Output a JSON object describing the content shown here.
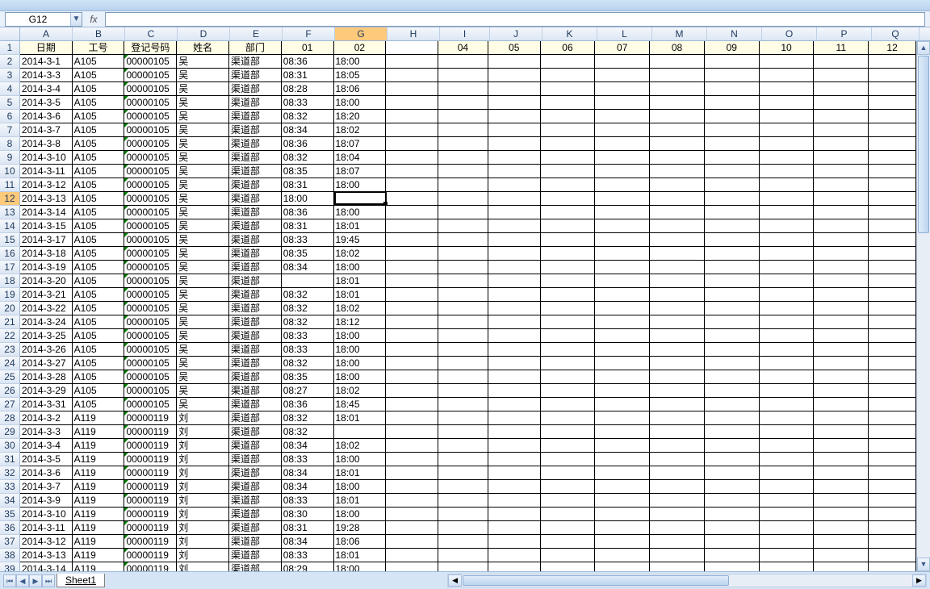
{
  "nameBox": "G12",
  "formulaBar": "",
  "colWidths": {
    "A": 65,
    "B": 65,
    "C": 65,
    "D": 65,
    "E": 65,
    "F": 65,
    "G": 65,
    "H": 65,
    "I": 62,
    "J": 65,
    "K": 68,
    "L": 68,
    "M": 68,
    "N": 68,
    "O": 68,
    "P": 68,
    "Q": 59
  },
  "columns": [
    "A",
    "B",
    "C",
    "D",
    "E",
    "F",
    "G",
    "H",
    "I",
    "J",
    "K",
    "L",
    "M",
    "N",
    "O",
    "P",
    "Q"
  ],
  "headerRow": [
    "日期",
    "工号",
    "登记号码",
    "姓名",
    "部门",
    "01",
    "02",
    "",
    "04",
    "05",
    "06",
    "07",
    "08",
    "09",
    "10",
    "11",
    "12"
  ],
  "activeCell": {
    "col": "G",
    "row": 12
  },
  "rows": [
    {
      "n": 2,
      "d": [
        "2014-3-1",
        "A105",
        "00000105",
        "吴",
        "渠道部",
        "08:36",
        "18:00"
      ]
    },
    {
      "n": 3,
      "d": [
        "2014-3-3",
        "A105",
        "00000105",
        "吴",
        "渠道部",
        "08:31",
        "18:05"
      ]
    },
    {
      "n": 4,
      "d": [
        "2014-3-4",
        "A105",
        "00000105",
        "吴",
        "渠道部",
        "08:28",
        "18:06"
      ]
    },
    {
      "n": 5,
      "d": [
        "2014-3-5",
        "A105",
        "00000105",
        "吴",
        "渠道部",
        "08:33",
        "18:00"
      ]
    },
    {
      "n": 6,
      "d": [
        "2014-3-6",
        "A105",
        "00000105",
        "吴",
        "渠道部",
        "08:32",
        "18:20"
      ]
    },
    {
      "n": 7,
      "d": [
        "2014-3-7",
        "A105",
        "00000105",
        "吴",
        "渠道部",
        "08:34",
        "18:02"
      ]
    },
    {
      "n": 8,
      "d": [
        "2014-3-8",
        "A105",
        "00000105",
        "吴",
        "渠道部",
        "08:36",
        "18:07"
      ]
    },
    {
      "n": 9,
      "d": [
        "2014-3-10",
        "A105",
        "00000105",
        "吴",
        "渠道部",
        "08:32",
        "18:04"
      ]
    },
    {
      "n": 10,
      "d": [
        "2014-3-11",
        "A105",
        "00000105",
        "吴",
        "渠道部",
        "08:35",
        "18:07"
      ]
    },
    {
      "n": 11,
      "d": [
        "2014-3-12",
        "A105",
        "00000105",
        "吴",
        "渠道部",
        "08:31",
        "18:00"
      ]
    },
    {
      "n": 12,
      "d": [
        "2014-3-13",
        "A105",
        "00000105",
        "吴",
        "渠道部",
        "18:00",
        ""
      ]
    },
    {
      "n": 13,
      "d": [
        "2014-3-14",
        "A105",
        "00000105",
        "吴",
        "渠道部",
        "08:36",
        "18:00"
      ]
    },
    {
      "n": 14,
      "d": [
        "2014-3-15",
        "A105",
        "00000105",
        "吴",
        "渠道部",
        "08:31",
        "18:01"
      ]
    },
    {
      "n": 15,
      "d": [
        "2014-3-17",
        "A105",
        "00000105",
        "吴",
        "渠道部",
        "08:33",
        "19:45"
      ]
    },
    {
      "n": 16,
      "d": [
        "2014-3-18",
        "A105",
        "00000105",
        "吴",
        "渠道部",
        "08:35",
        "18:02"
      ]
    },
    {
      "n": 17,
      "d": [
        "2014-3-19",
        "A105",
        "00000105",
        "吴",
        "渠道部",
        "08:34",
        "18:00"
      ]
    },
    {
      "n": 18,
      "d": [
        "2014-3-20",
        "A105",
        "00000105",
        "吴",
        "渠道部",
        "",
        "18:01"
      ]
    },
    {
      "n": 19,
      "d": [
        "2014-3-21",
        "A105",
        "00000105",
        "吴",
        "渠道部",
        "08:32",
        "18:01"
      ]
    },
    {
      "n": 20,
      "d": [
        "2014-3-22",
        "A105",
        "00000105",
        "吴",
        "渠道部",
        "08:32",
        "18:02"
      ]
    },
    {
      "n": 21,
      "d": [
        "2014-3-24",
        "A105",
        "00000105",
        "吴",
        "渠道部",
        "08:32",
        "18:12"
      ]
    },
    {
      "n": 22,
      "d": [
        "2014-3-25",
        "A105",
        "00000105",
        "吴",
        "渠道部",
        "08:33",
        "18:00"
      ]
    },
    {
      "n": 23,
      "d": [
        "2014-3-26",
        "A105",
        "00000105",
        "吴",
        "渠道部",
        "08:33",
        "18:00"
      ]
    },
    {
      "n": 24,
      "d": [
        "2014-3-27",
        "A105",
        "00000105",
        "吴",
        "渠道部",
        "08:32",
        "18:00"
      ]
    },
    {
      "n": 25,
      "d": [
        "2014-3-28",
        "A105",
        "00000105",
        "吴",
        "渠道部",
        "08:35",
        "18:00"
      ]
    },
    {
      "n": 26,
      "d": [
        "2014-3-29",
        "A105",
        "00000105",
        "吴",
        "渠道部",
        "08:27",
        "18:02"
      ]
    },
    {
      "n": 27,
      "d": [
        "2014-3-31",
        "A105",
        "00000105",
        "吴",
        "渠道部",
        "08:36",
        "18:45"
      ]
    },
    {
      "n": 28,
      "d": [
        "2014-3-2",
        "A119",
        "00000119",
        "刘",
        "渠道部",
        "08:32",
        "18:01"
      ]
    },
    {
      "n": 29,
      "d": [
        "2014-3-3",
        "A119",
        "00000119",
        "刘",
        "渠道部",
        "08:32",
        ""
      ]
    },
    {
      "n": 30,
      "d": [
        "2014-3-4",
        "A119",
        "00000119",
        "刘",
        "渠道部",
        "08:34",
        "18:02"
      ]
    },
    {
      "n": 31,
      "d": [
        "2014-3-5",
        "A119",
        "00000119",
        "刘",
        "渠道部",
        "08:33",
        "18:00"
      ]
    },
    {
      "n": 32,
      "d": [
        "2014-3-6",
        "A119",
        "00000119",
        "刘",
        "渠道部",
        "08:34",
        "18:01"
      ]
    },
    {
      "n": 33,
      "d": [
        "2014-3-7",
        "A119",
        "00000119",
        "刘",
        "渠道部",
        "08:34",
        "18:00"
      ]
    },
    {
      "n": 34,
      "d": [
        "2014-3-9",
        "A119",
        "00000119",
        "刘",
        "渠道部",
        "08:33",
        "18:01"
      ]
    },
    {
      "n": 35,
      "d": [
        "2014-3-10",
        "A119",
        "00000119",
        "刘",
        "渠道部",
        "08:30",
        "18:00"
      ]
    },
    {
      "n": 36,
      "d": [
        "2014-3-11",
        "A119",
        "00000119",
        "刘",
        "渠道部",
        "08:31",
        "19:28"
      ]
    },
    {
      "n": 37,
      "d": [
        "2014-3-12",
        "A119",
        "00000119",
        "刘",
        "渠道部",
        "08:34",
        "18:06"
      ]
    },
    {
      "n": 38,
      "d": [
        "2014-3-13",
        "A119",
        "00000119",
        "刘",
        "渠道部",
        "08:33",
        "18:01"
      ]
    },
    {
      "n": 39,
      "d": [
        "2014-3-14",
        "A119",
        "00000119",
        "刘",
        "渠道部",
        "08:29",
        "18:00"
      ]
    }
  ],
  "sheetTab": "Sheet1",
  "navIcons": [
    "⏮",
    "◀",
    "▶",
    "⏭"
  ]
}
